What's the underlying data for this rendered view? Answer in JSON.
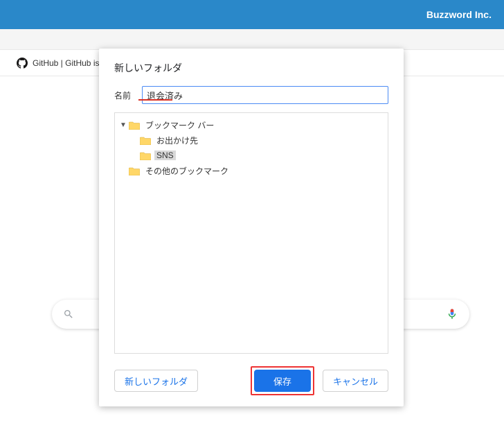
{
  "brand": "Buzzword Inc.",
  "bookmark_bar": {
    "item": "GitHub | GitHub is..."
  },
  "search": {
    "placeholder": ""
  },
  "dialog": {
    "title": "新しいフォルダ",
    "name_label": "名前",
    "name_value": "退会済み",
    "tree": {
      "root": {
        "label": "ブックマーク バー",
        "expanded": true
      },
      "children": [
        {
          "label": "お出かけ先",
          "selected": false
        },
        {
          "label": "SNS",
          "selected": true
        }
      ],
      "other": {
        "label": "その他のブックマーク"
      }
    },
    "buttons": {
      "new_folder": "新しいフォルダ",
      "save": "保存",
      "cancel": "キャンセル"
    }
  },
  "colors": {
    "accent": "#1a73e8",
    "highlight_ring": "#e33"
  }
}
